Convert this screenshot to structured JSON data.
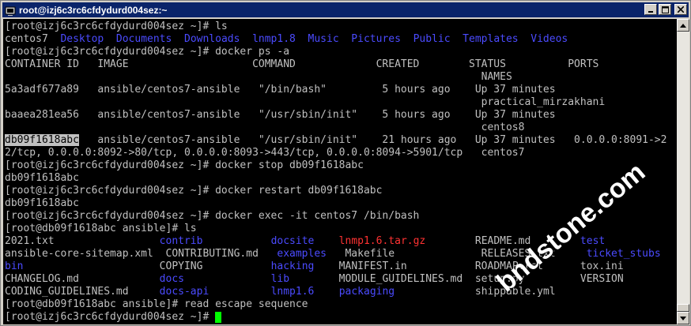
{
  "window": {
    "title": "root@izj6c3rc6cfdydurd004sez:~"
  },
  "terminal": {
    "lines": [
      [
        {
          "t": "[root@izj6c3rc6cfdydurd004sez ~]# ls",
          "c": "white"
        }
      ],
      [
        {
          "t": "centos7  ",
          "c": "white"
        },
        {
          "t": "Desktop  Documents  Downloads  lnmp1.8  Music  Pictures  Public  Templates  Videos",
          "c": "blue"
        }
      ],
      [
        {
          "t": "[root@izj6c3rc6cfdydurd004sez ~]# docker ps -a",
          "c": "white"
        }
      ],
      [
        {
          "t": "CONTAINER ID   IMAGE                    COMMAND             CREATED        STATUS          PORTS",
          "c": "white"
        }
      ],
      [
        {
          "t": "                                                                             NAMES",
          "c": "white"
        }
      ],
      [
        {
          "t": "5a3adf677a89   ansible/centos7-ansible   \"/bin/bash\"         5 hours ago    Up 37 minutes",
          "c": "white"
        }
      ],
      [
        {
          "t": "                                                                             practical_mirzakhani",
          "c": "white"
        }
      ],
      [
        {
          "t": "baaea281ea56   ansible/centos7-ansible   \"/usr/sbin/init\"    5 hours ago    Up 37 minutes",
          "c": "white"
        }
      ],
      [
        {
          "t": "                                                                             centos8",
          "c": "white"
        }
      ],
      [
        {
          "t": "db09f1618abc",
          "c": "hl"
        },
        {
          "t": "   ansible/centos7-ansible   \"/usr/sbin/init\"    21 hours ago   Up 37 minutes   0.0.0.0:8091->2",
          "c": "white"
        }
      ],
      [
        {
          "t": "2/tcp, 0.0.0.0:8092->80/tcp, 0.0.0.0:8093->443/tcp, 0.0.0.0:8094->5901/tcp   centos7",
          "c": "white"
        }
      ],
      [
        {
          "t": "[root@izj6c3rc6cfdydurd004sez ~]# docker stop db09f1618abc",
          "c": "white"
        }
      ],
      [
        {
          "t": "db09f1618abc",
          "c": "white"
        }
      ],
      [
        {
          "t": "[root@izj6c3rc6cfdydurd004sez ~]# docker restart db09f1618abc",
          "c": "white"
        }
      ],
      [
        {
          "t": "db09f1618abc",
          "c": "white"
        }
      ],
      [
        {
          "t": "[root@izj6c3rc6cfdydurd004sez ~]# docker exec -it centos7 /bin/bash",
          "c": "white"
        }
      ],
      [
        {
          "t": "[root@db09f1618abc ansible]# ls",
          "c": "white"
        }
      ],
      [
        {
          "t": "2021.txt                 ",
          "c": "white"
        },
        {
          "t": "contrib",
          "c": "blue"
        },
        {
          "t": "           ",
          "c": "white"
        },
        {
          "t": "docsite",
          "c": "blue"
        },
        {
          "t": "    ",
          "c": "white"
        },
        {
          "t": "lnmp1.6.tar.gz",
          "c": "red"
        },
        {
          "t": "        README.md        ",
          "c": "white"
        },
        {
          "t": "test",
          "c": "blue"
        }
      ],
      [
        {
          "t": "ansible-core-sitemap.xml  CONTRIBUTING.md   ",
          "c": "white"
        },
        {
          "t": "examples",
          "c": "blue"
        },
        {
          "t": "   Makefile              RELEASES.txt     ",
          "c": "white"
        },
        {
          "t": "ticket_stubs",
          "c": "blue"
        }
      ],
      [
        {
          "t": "bin",
          "c": "blue"
        },
        {
          "t": "                      COPYING           ",
          "c": "white"
        },
        {
          "t": "hacking",
          "c": "blue"
        },
        {
          "t": "    MANIFEST.in           ROADMAP.rst      tox.ini",
          "c": "white"
        }
      ],
      [
        {
          "t": "CHANGELOG.md             ",
          "c": "white"
        },
        {
          "t": "docs",
          "c": "blue"
        },
        {
          "t": "              ",
          "c": "white"
        },
        {
          "t": "lib",
          "c": "blue"
        },
        {
          "t": "        MODULE_GUIDELINES.md  setup.py         VERSION",
          "c": "white"
        }
      ],
      [
        {
          "t": "CODING_GUIDELINES.md     ",
          "c": "white"
        },
        {
          "t": "docs-api",
          "c": "blue"
        },
        {
          "t": "          ",
          "c": "white"
        },
        {
          "t": "lnmp1.6",
          "c": "blue"
        },
        {
          "t": "    ",
          "c": "white"
        },
        {
          "t": "packaging",
          "c": "blue"
        },
        {
          "t": "             shippable.yml",
          "c": "white"
        }
      ],
      [
        {
          "t": "[root@db09f1618abc ansible]# read escape sequence",
          "c": "white"
        }
      ],
      [
        {
          "t": "[root@izj6c3rc6cfdydurd004sez ~]# ",
          "c": "white"
        },
        {
          "t": "",
          "c": "cursor"
        }
      ]
    ]
  },
  "watermark": "bndstone.com",
  "colors": {
    "titlebar": "#0a246a",
    "terminal_bg": "#000000",
    "text": "#c0c0c0",
    "dir": "#4b4bff",
    "archive": "#ff3232",
    "cursor": "#00ff00"
  }
}
